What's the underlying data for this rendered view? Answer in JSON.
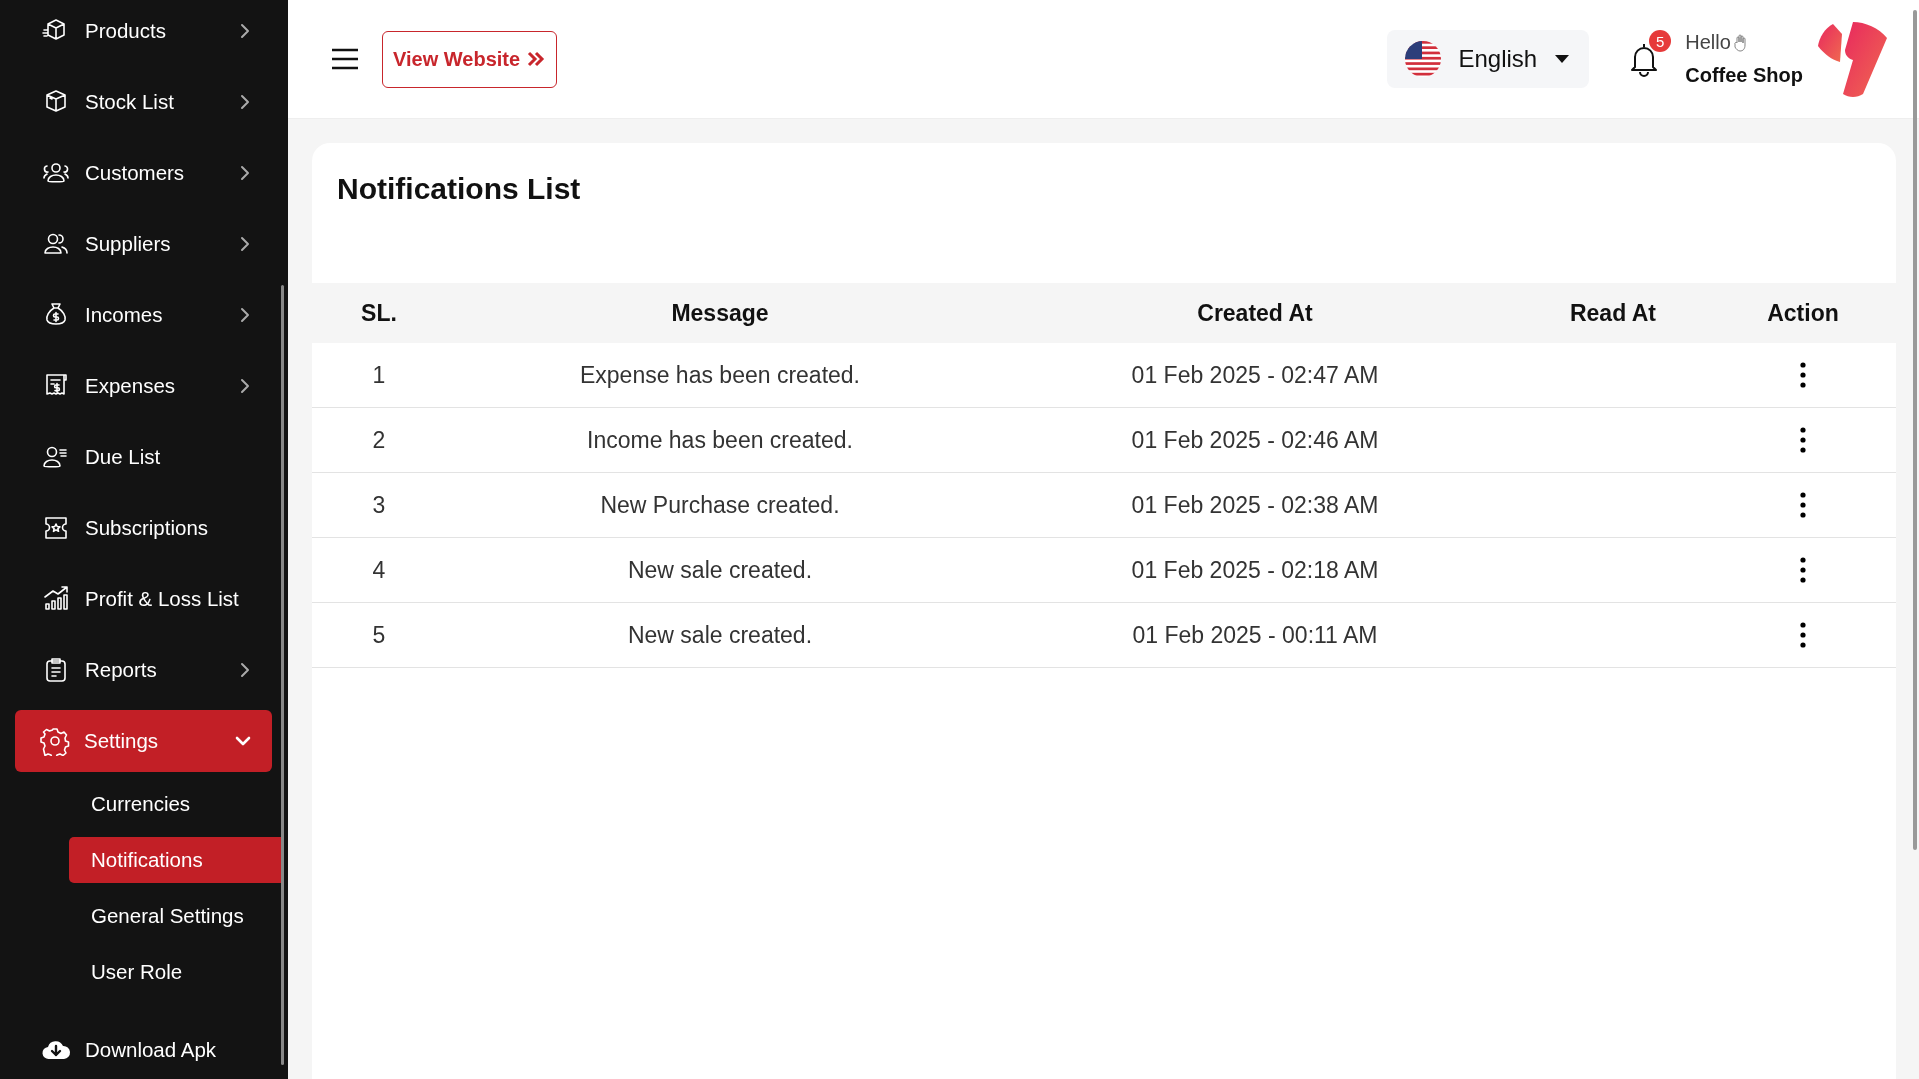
{
  "sidebar": {
    "items": [
      {
        "label": "Products",
        "expanded": false,
        "selected": false
      },
      {
        "label": "Stock List",
        "expanded": false,
        "selected": false
      },
      {
        "label": "Customers",
        "expanded": false,
        "selected": false
      },
      {
        "label": "Suppliers",
        "expanded": false,
        "selected": false
      },
      {
        "label": "Incomes",
        "expanded": false,
        "selected": false
      },
      {
        "label": "Expenses",
        "expanded": false,
        "selected": false
      },
      {
        "label": "Due List",
        "selected": false
      },
      {
        "label": "Subscriptions",
        "selected": false
      },
      {
        "label": "Profit & Loss List",
        "selected": false
      },
      {
        "label": "Reports",
        "expanded": false,
        "selected": false
      },
      {
        "label": "Settings",
        "expanded": true,
        "selected": true,
        "children": [
          {
            "label": "Currencies",
            "selected": false
          },
          {
            "label": "Notifications",
            "selected": true
          },
          {
            "label": "General Settings",
            "selected": false
          },
          {
            "label": "User Role",
            "selected": false
          }
        ]
      },
      {
        "label": "Download Apk",
        "selected": false
      }
    ]
  },
  "header": {
    "view_website": "View Website",
    "language": "English",
    "notification_count": "5",
    "greeting": "Hello",
    "user_name": "Coffee Shop"
  },
  "page": {
    "title": "Notifications List"
  },
  "table": {
    "columns": [
      "SL.",
      "Message",
      "Created At",
      "Read At",
      "Action"
    ],
    "rows": [
      {
        "sl": "1",
        "message": "Expense has been created.",
        "created_at": "01 Feb 2025 - 02:47 AM"
      },
      {
        "sl": "2",
        "message": "Income has been created.",
        "created_at": "01 Feb 2025 - 02:46 AM"
      },
      {
        "sl": "3",
        "message": "New Purchase created.",
        "created_at": "01 Feb 2025 - 02:38 AM"
      },
      {
        "sl": "4",
        "message": "New sale created.",
        "created_at": "01 Feb 2025 - 02:18 AM"
      },
      {
        "sl": "5",
        "message": "New sale created.",
        "created_at": "01 Feb 2025 - 00:11 AM"
      }
    ]
  }
}
